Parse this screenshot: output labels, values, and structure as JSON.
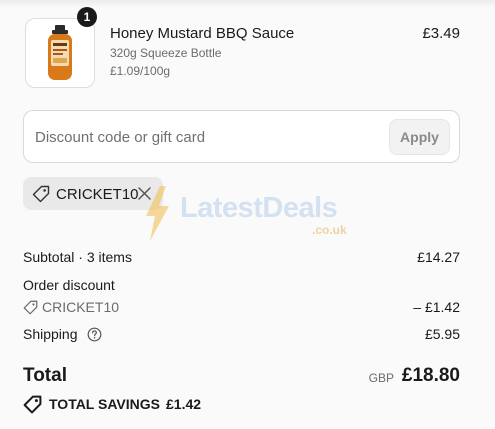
{
  "product": {
    "quantity": "1",
    "name": "Honey Mustard BBQ Sauce",
    "variant": "320g Squeeze Bottle",
    "unit_price": "£1.09/100g",
    "price": "£3.49"
  },
  "discount": {
    "placeholder": "Discount code or gift card",
    "apply_label": "Apply",
    "applied_code": "CRICKET10"
  },
  "watermark": {
    "brand": "LatestDeals",
    "domain": ".co.uk"
  },
  "summary": {
    "subtotal_label": "Subtotal · 3 items",
    "subtotal_value": "£14.27",
    "order_discount_label": "Order discount",
    "discount_code": "CRICKET10",
    "discount_value": "– £1.42",
    "shipping_label": "Shipping",
    "shipping_value": "£5.95",
    "total_label": "Total",
    "currency": "GBP",
    "total_value": "£18.80",
    "savings_label": "TOTAL SAVINGS",
    "savings_value": "£1.42"
  },
  "colors": {
    "background": "#fafafa",
    "text": "#1a1a1a",
    "muted": "#6b6b6b",
    "chip": "#e9e9e9",
    "bottle_orange": "#d9791a"
  },
  "icons": [
    "tag-icon",
    "close-icon",
    "help-circle-icon",
    "savings-tag-icon",
    "lightning-bolt-icon"
  ]
}
